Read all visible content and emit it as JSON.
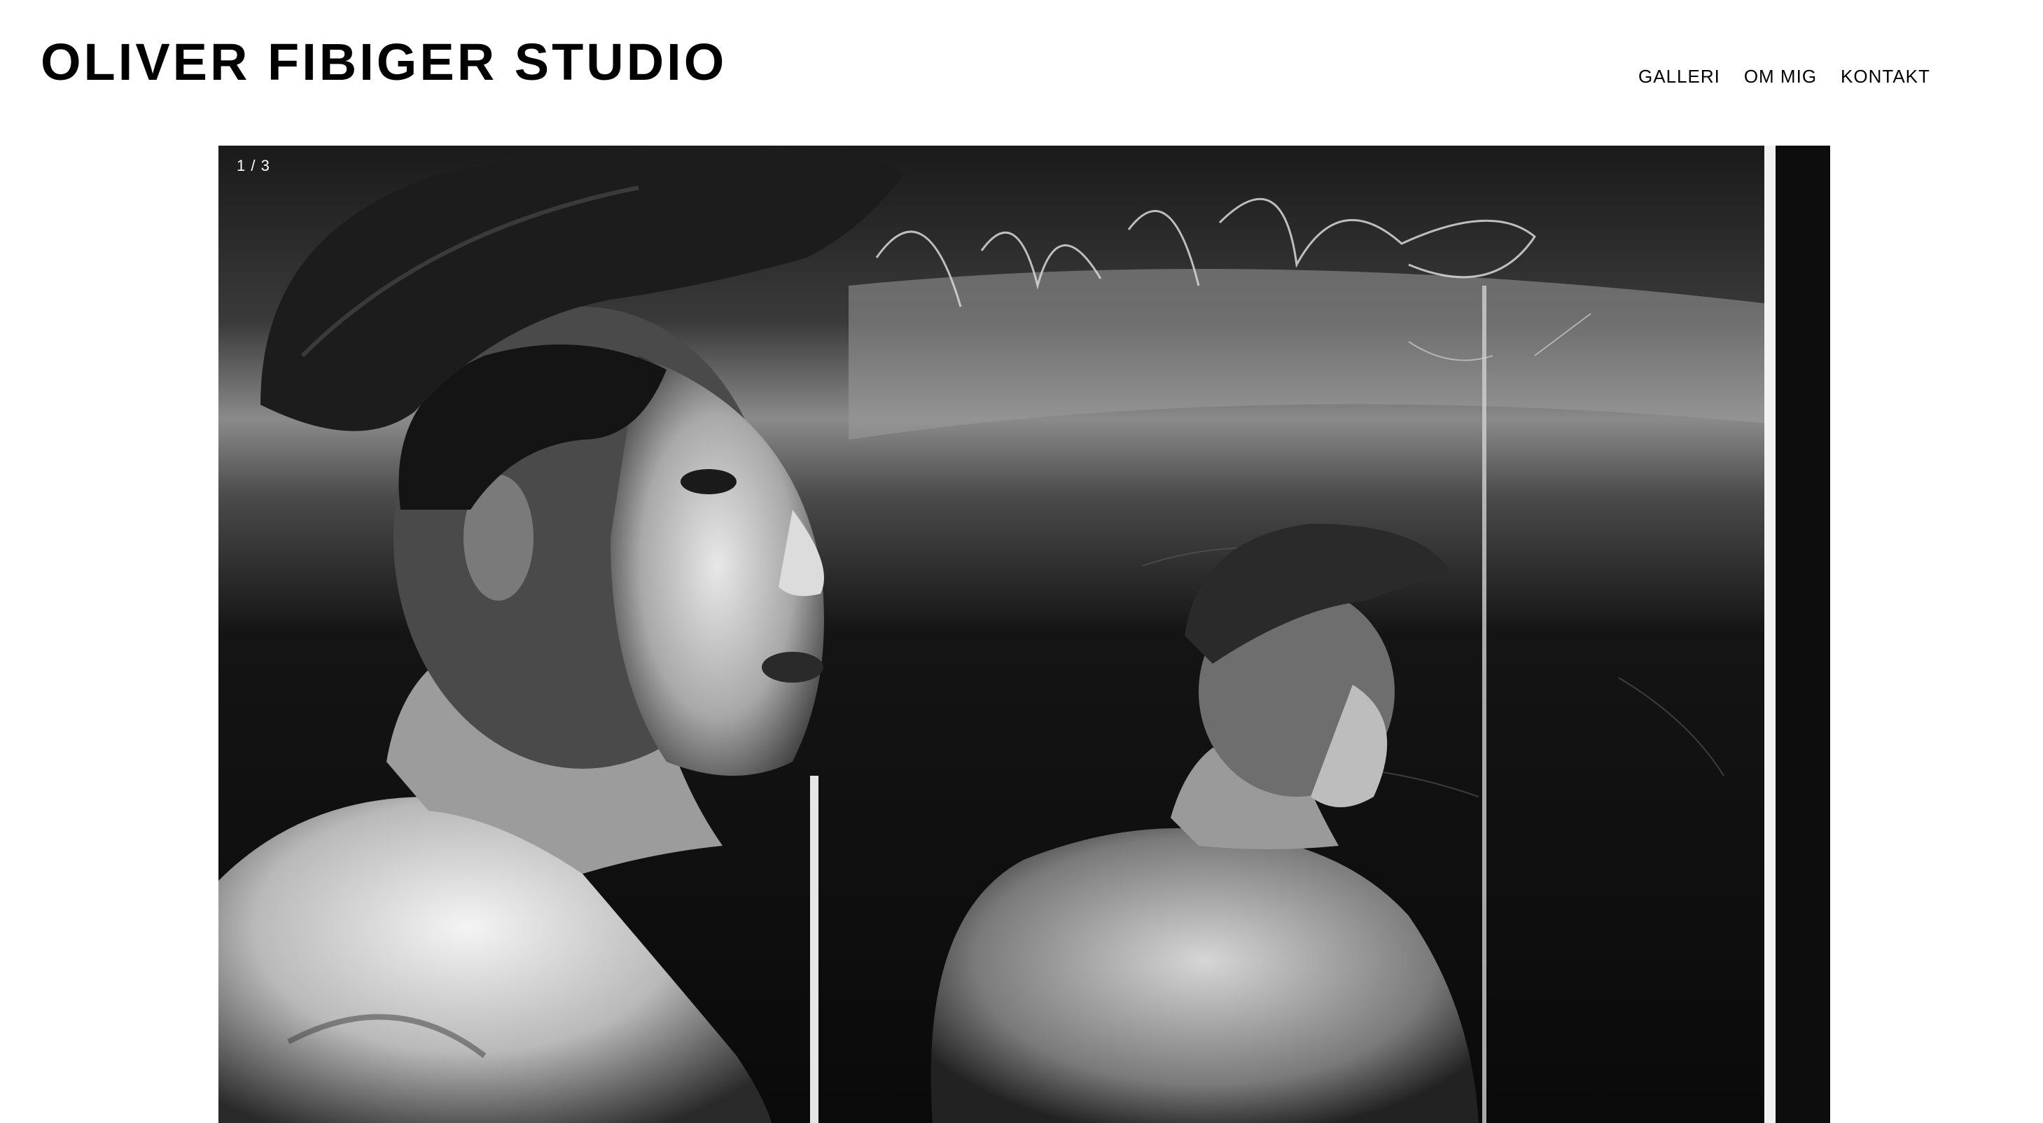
{
  "header": {
    "site_title": "OLIVER FIBIGER STUDIO"
  },
  "nav": {
    "items": [
      {
        "label": "GALLERI"
      },
      {
        "label": "OM MIG"
      },
      {
        "label": "KONTAKT"
      }
    ]
  },
  "slideshow": {
    "counter": "1 / 3",
    "current": 1,
    "total": 3
  },
  "colors": {
    "background": "#ffffff",
    "text": "#000000",
    "counter_text": "#ffffff"
  }
}
